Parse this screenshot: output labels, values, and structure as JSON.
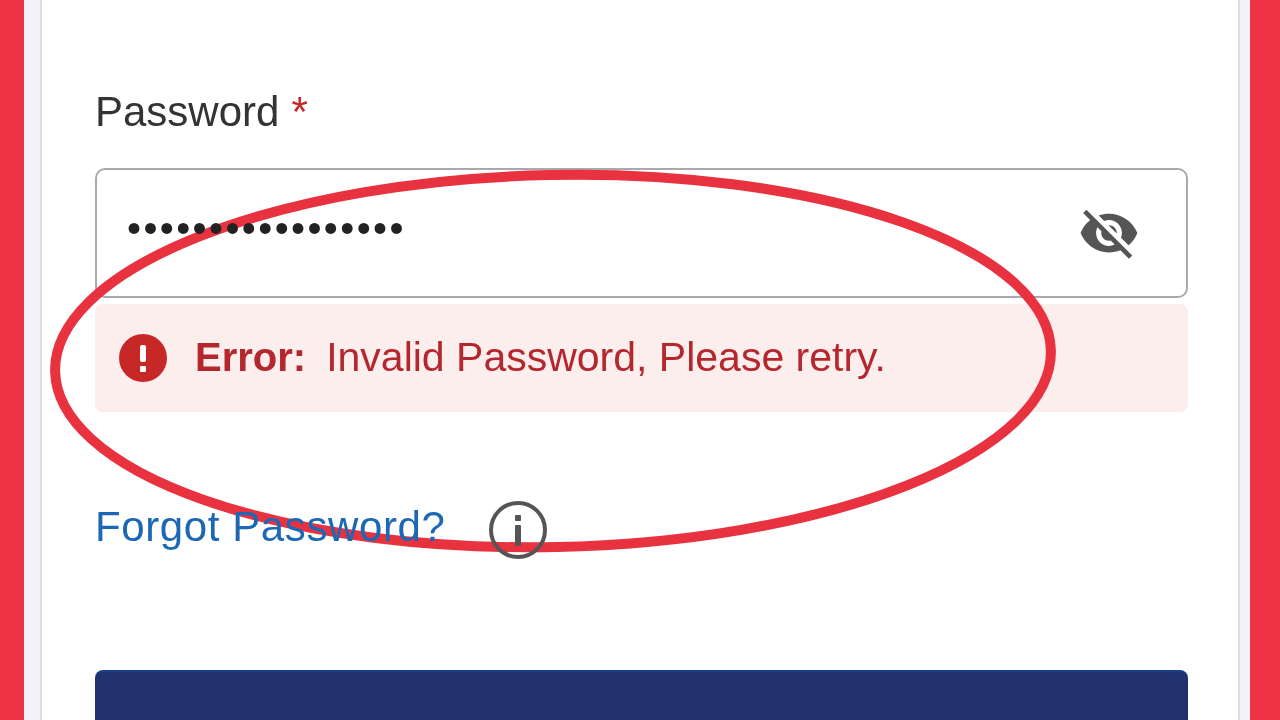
{
  "password_field": {
    "label": "Password",
    "required_mark": "*",
    "value": "•••••••••••••••••",
    "password_visible": false
  },
  "error_alert": {
    "title": "Error:",
    "message": "Invalid Password, Please retry."
  },
  "forgot_password_link": {
    "label": "Forgot Password?"
  }
}
